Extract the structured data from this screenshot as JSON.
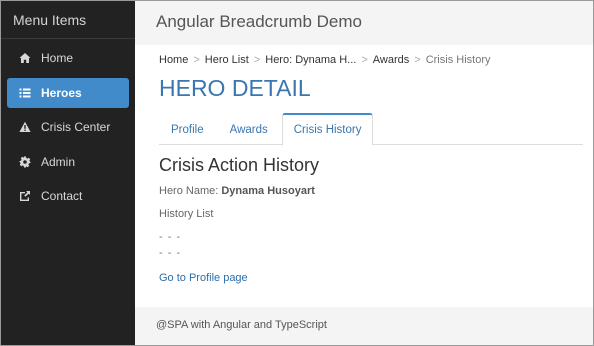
{
  "sidebar": {
    "title": "Menu Items",
    "items": [
      {
        "label": "Home",
        "icon": "home-icon",
        "active": false
      },
      {
        "label": "Heroes",
        "icon": "list-icon",
        "active": true
      },
      {
        "label": "Crisis Center",
        "icon": "warning-icon",
        "active": false
      },
      {
        "label": "Admin",
        "icon": "gear-icon",
        "active": false
      },
      {
        "label": "Contact",
        "icon": "share-icon",
        "active": false
      }
    ]
  },
  "header": {
    "title": "Angular Breadcrumb Demo"
  },
  "breadcrumb": {
    "items": [
      "Home",
      "Hero List",
      "Hero: Dynama H...",
      "Awards",
      "Crisis History"
    ],
    "separator": ">"
  },
  "main": {
    "page_title": "HERO DETAIL",
    "tabs": [
      {
        "label": "Profile",
        "active": false
      },
      {
        "label": "Awards",
        "active": false
      },
      {
        "label": "Crisis History",
        "active": true
      }
    ],
    "section_title": "Crisis Action History",
    "hero_name_label": "Hero Name:",
    "hero_name_value": "Dynama Husoyart",
    "history_label": "History List",
    "history_items": [
      "- - -",
      "- - -"
    ],
    "profile_link": "Go to Profile page"
  },
  "footer": {
    "text": "@SPA with Angular and TypeScript"
  },
  "colors": {
    "sidebar_bg": "#222222",
    "active_item": "#428bca",
    "title_blue": "#3a77b0",
    "header_bg": "#f4f4f4"
  }
}
